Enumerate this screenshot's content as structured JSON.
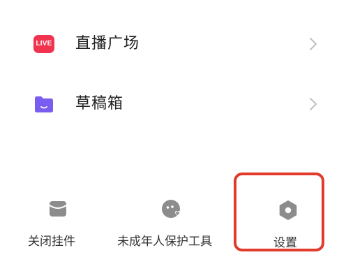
{
  "menu": {
    "items": [
      {
        "label": "直播广场",
        "icon": "live-badge-icon",
        "badge_text": "LIVE",
        "icon_color": "#f0344f"
      },
      {
        "label": "草稿箱",
        "icon": "folder-icon",
        "icon_color": "#7a5cf0"
      }
    ],
    "partial_item_icon_color": "#f0a63a"
  },
  "tools": {
    "close_widget_label": "关闭挂件",
    "minor_protect_label": "未成年人保护工具",
    "settings_label": "设置"
  },
  "colors": {
    "highlight": "#e23a2b",
    "icon_gray": "#8c8c8c",
    "text": "#222222"
  }
}
